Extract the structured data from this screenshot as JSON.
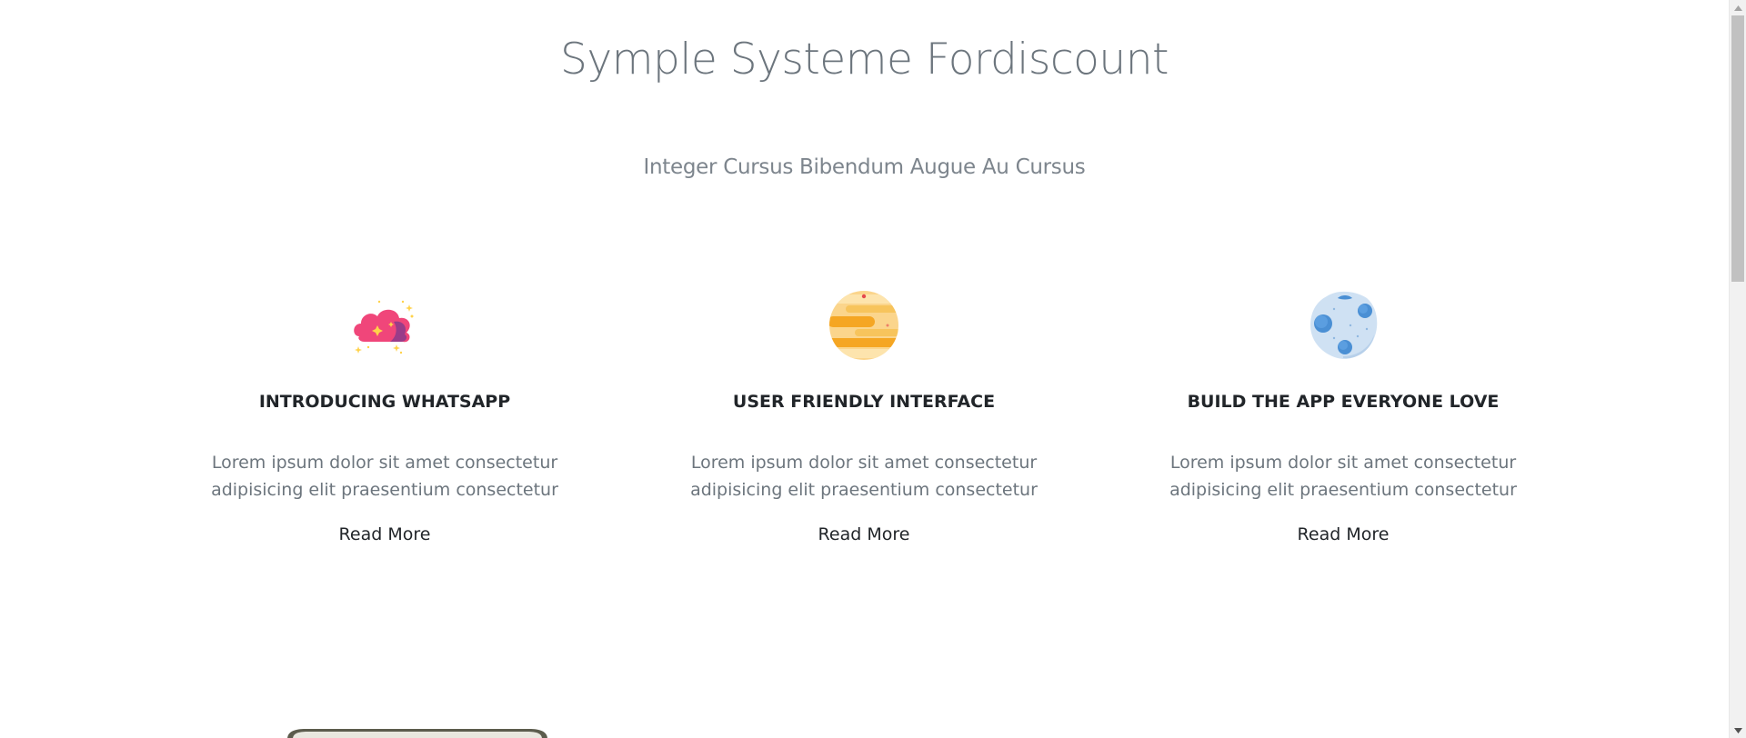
{
  "header": {
    "title": "Symple Systeme Fordiscount",
    "subtitle": "Integer Cursus Bibendum Augue Au Cursus"
  },
  "features": [
    {
      "icon": "nebula-cloud-icon",
      "title": "INTRODUCING WHATSAPP",
      "text": "Lorem ipsum dolor sit amet consectetur adipisicing elit praesentium consectetur",
      "link": "Read More"
    },
    {
      "icon": "planet-icon",
      "title": "USER FRIENDLY INTERFACE",
      "text": "Lorem ipsum dolor sit amet consectetur adipisicing elit praesentium consectetur",
      "link": "Read More"
    },
    {
      "icon": "moon-icon",
      "title": "BUILD THE APP EVERYONE LOVE",
      "text": "Lorem ipsum dolor sit amet consectetur adipisicing elit praesentium consectetur",
      "link": "Read More"
    }
  ],
  "colors": {
    "title": "#6c757d",
    "heading": "#212529",
    "body_text": "#6c757d",
    "nebula_pink": "#f0467a",
    "planet_orange": "#f5a623",
    "moon_blue": "#4a8fd4"
  }
}
